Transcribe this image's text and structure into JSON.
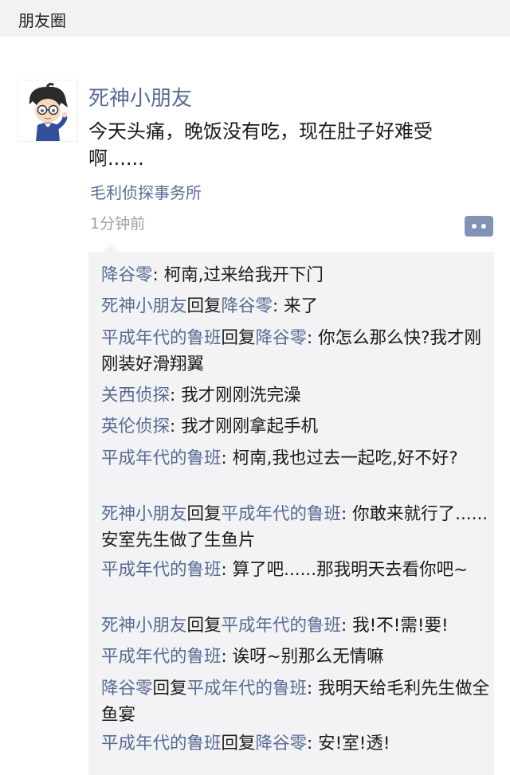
{
  "topbar": {
    "title": "朋友圈"
  },
  "post": {
    "username": "死神小朋友",
    "text": "今天头痛，晚饭没有吃，现在肚子好难受啊......",
    "location": "毛利侦探事务所",
    "time": "1分钟前",
    "avatar_icon": "conan-avatar-icon",
    "more_icon": "comment-dots-icon"
  },
  "comments": [
    {
      "from": "降谷零",
      "reply_word": "",
      "to": "",
      "sep": ": ",
      "text": "柯南,过来给我开下门"
    },
    {
      "from": "死神小朋友",
      "reply_word": "回复",
      "to": "降谷零",
      "sep": ": ",
      "text": "来了"
    },
    {
      "from": "平成年代的鲁班",
      "reply_word": "回复",
      "to": "降谷零",
      "sep": ": ",
      "text": "你怎么那么快?我才刚刚装好滑翔翼"
    },
    {
      "from": "关西侦探",
      "reply_word": "",
      "to": "",
      "sep": ": ",
      "text": "我才刚刚洗完澡"
    },
    {
      "from": "英伦侦探",
      "reply_word": "",
      "to": "",
      "sep": ": ",
      "text": "我才刚刚拿起手机"
    },
    {
      "from": "平成年代的鲁班",
      "reply_word": "",
      "to": "",
      "sep": ": ",
      "text": "柯南,我也过去一起吃,好不好?"
    },
    {
      "from": "死神小朋友",
      "reply_word": "回复",
      "to": "平成年代的鲁班",
      "sep": ": ",
      "text": "你敢来就行了......安室先生做了生鱼片"
    },
    {
      "from": "平成年代的鲁班",
      "reply_word": "",
      "to": "",
      "sep": ": ",
      "text": "算了吧......那我明天去看你吧~"
    },
    {
      "from": "死神小朋友",
      "reply_word": "回复",
      "to": "平成年代的鲁班",
      "sep": ": ",
      "text": "我!不!需!要!"
    },
    {
      "from": "平成年代的鲁班",
      "reply_word": "",
      "to": "",
      "sep": ": ",
      "text": "诶呀~别那么无情嘛"
    },
    {
      "from": "降谷零",
      "reply_word": "回复",
      "to": "平成年代的鲁班",
      "sep": ": ",
      "text": "我明天给毛利先生做全鱼宴"
    },
    {
      "from": "平成年代的鲁班",
      "reply_word": "回复",
      "to": "降谷零",
      "sep": ": ",
      "text": "安!室!透!"
    }
  ],
  "colors": {
    "link": "#576b95",
    "text": "#1a1a1a",
    "muted": "#a0a0a0",
    "comment_bg": "#f3f3f5"
  }
}
